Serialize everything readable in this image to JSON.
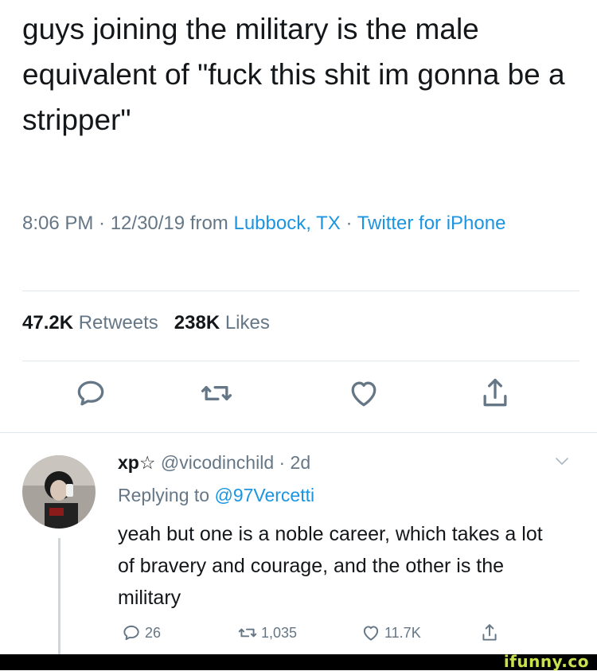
{
  "tweet": {
    "text": "guys joining the military is the male equivalent of \"fuck this shit im gonna be a stripper\"",
    "time": "8:06 PM · 12/30/19 from ",
    "location": "Lubbock, TX",
    "separator": " · ",
    "source": "Twitter for iPhone",
    "retweets_count": "47.2K",
    "retweets_label": "Retweets",
    "likes_count": "238K",
    "likes_label": "Likes"
  },
  "actions": {
    "reply_icon": "reply-bubble-icon",
    "retweet_icon": "retweet-icon",
    "like_icon": "heart-icon",
    "share_icon": "share-icon"
  },
  "reply": {
    "name": "xp☆",
    "handle": "@vicodinchild",
    "age": "· 2d",
    "replying_prefix": "Replying to ",
    "replying_to": "@97Vercetti",
    "text": "yeah but one is a noble career, which takes a lot of bravery and courage, and the other is the military",
    "replies_count": "26",
    "retweets_count": "1,035",
    "likes_count": "11.7K"
  },
  "watermark": {
    "brand": "ifunny.co"
  },
  "colors": {
    "link": "#1b95e0",
    "muted": "#657786",
    "text": "#14171a",
    "divider": "#e1e8ed",
    "brand": "#c7e24b"
  }
}
